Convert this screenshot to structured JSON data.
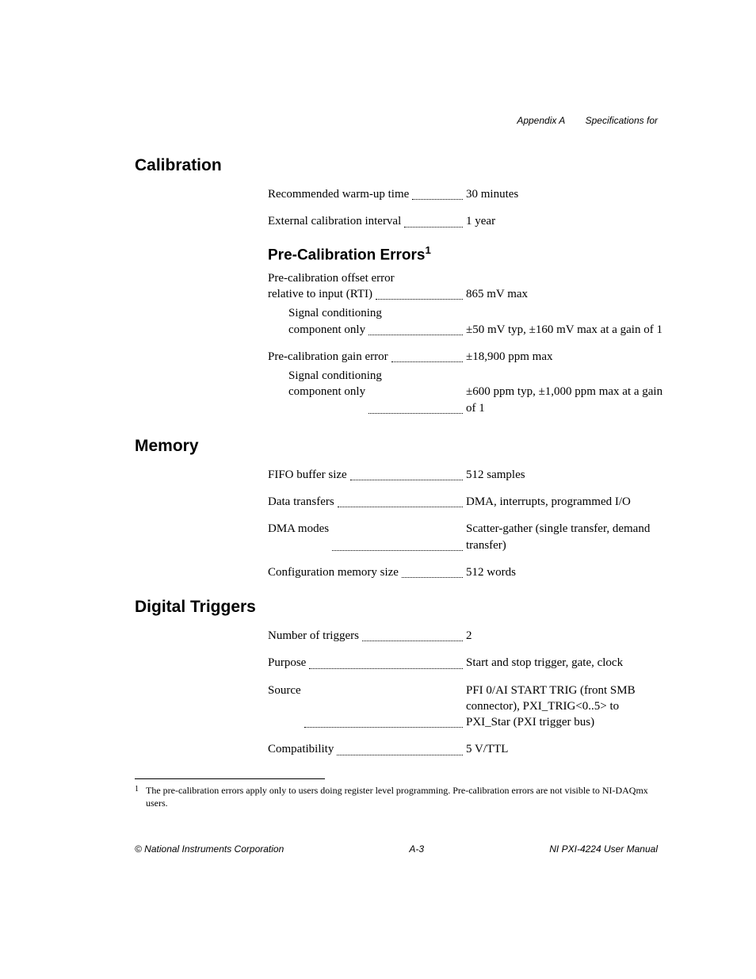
{
  "header": {
    "appendix": "Appendix A",
    "title": "Specifications for"
  },
  "sections": {
    "calibration": {
      "heading": "Calibration",
      "warmup": {
        "label": "Recommended warm-up time",
        "value": "30 minutes"
      },
      "interval": {
        "label": "External calibration interval",
        "value": "1 year"
      },
      "precal": {
        "heading": "Pre-Calibration Errors",
        "sup": "1",
        "offset": {
          "label1": "Pre-calibration offset error",
          "label2": "relative to input (RTI)",
          "value": "865 mV max",
          "sub_label1": "Signal conditioning",
          "sub_label2": "component only",
          "sub_value": "±50 mV typ, ±160 mV max at a gain of 1"
        },
        "gain": {
          "label": "Pre-calibration gain error",
          "value": "±18,900 ppm max",
          "sub_label1": "Signal conditioning",
          "sub_label2": "component only",
          "sub_value": "±600 ppm typ, ±1,000 ppm max at a gain of 1"
        }
      }
    },
    "memory": {
      "heading": "Memory",
      "fifo": {
        "label": "FIFO buffer size",
        "value": "512 samples"
      },
      "transfers": {
        "label": "Data transfers",
        "value": "DMA, interrupts, programmed I/O"
      },
      "dma": {
        "label": "DMA modes",
        "value": "Scatter-gather (single transfer, demand transfer)"
      },
      "config": {
        "label": "Configuration memory size",
        "value": "512 words"
      }
    },
    "triggers": {
      "heading": "Digital Triggers",
      "number": {
        "label": "Number of triggers",
        "value": "2"
      },
      "purpose": {
        "label": "Purpose",
        "value": "Start and stop trigger, gate, clock"
      },
      "source": {
        "label": "Source",
        "value": "PFI 0/AI START TRIG (front SMB connector), PXI_TRIG<0..5> to PXI_Star (PXI trigger bus)"
      },
      "compat": {
        "label": "Compatibility",
        "value": "5 V/TTL"
      }
    }
  },
  "footnote": {
    "num": "1",
    "text": "The pre-calibration errors apply only to users doing register level programming. Pre-calibration errors are not visible to NI-DAQmx users."
  },
  "footer": {
    "left": "© National Instruments Corporation",
    "center": "A-3",
    "right": "NI PXI-4224 User Manual"
  }
}
